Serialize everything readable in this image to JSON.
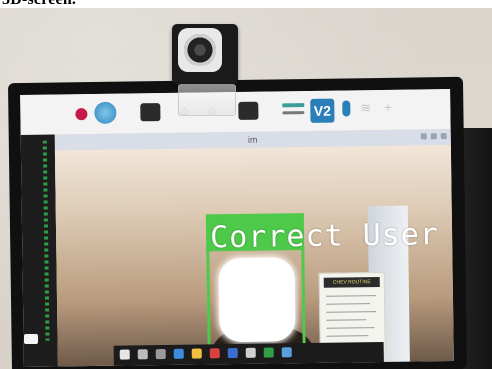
{
  "caption": "3D-screen.",
  "window": {
    "title": "im"
  },
  "camera": {
    "overlay_label": "Correct User",
    "box_color": "#4ec94a"
  },
  "taskbar": {
    "vnc_glyph": "V2"
  },
  "poster": {
    "header": "CHEV ROUTINE"
  },
  "icons": [
    "raspberry-pi-icon",
    "browser-globe-icon",
    "terminal-icon",
    "vnc-icon",
    "bluetooth-icon",
    "webcam-icon"
  ]
}
